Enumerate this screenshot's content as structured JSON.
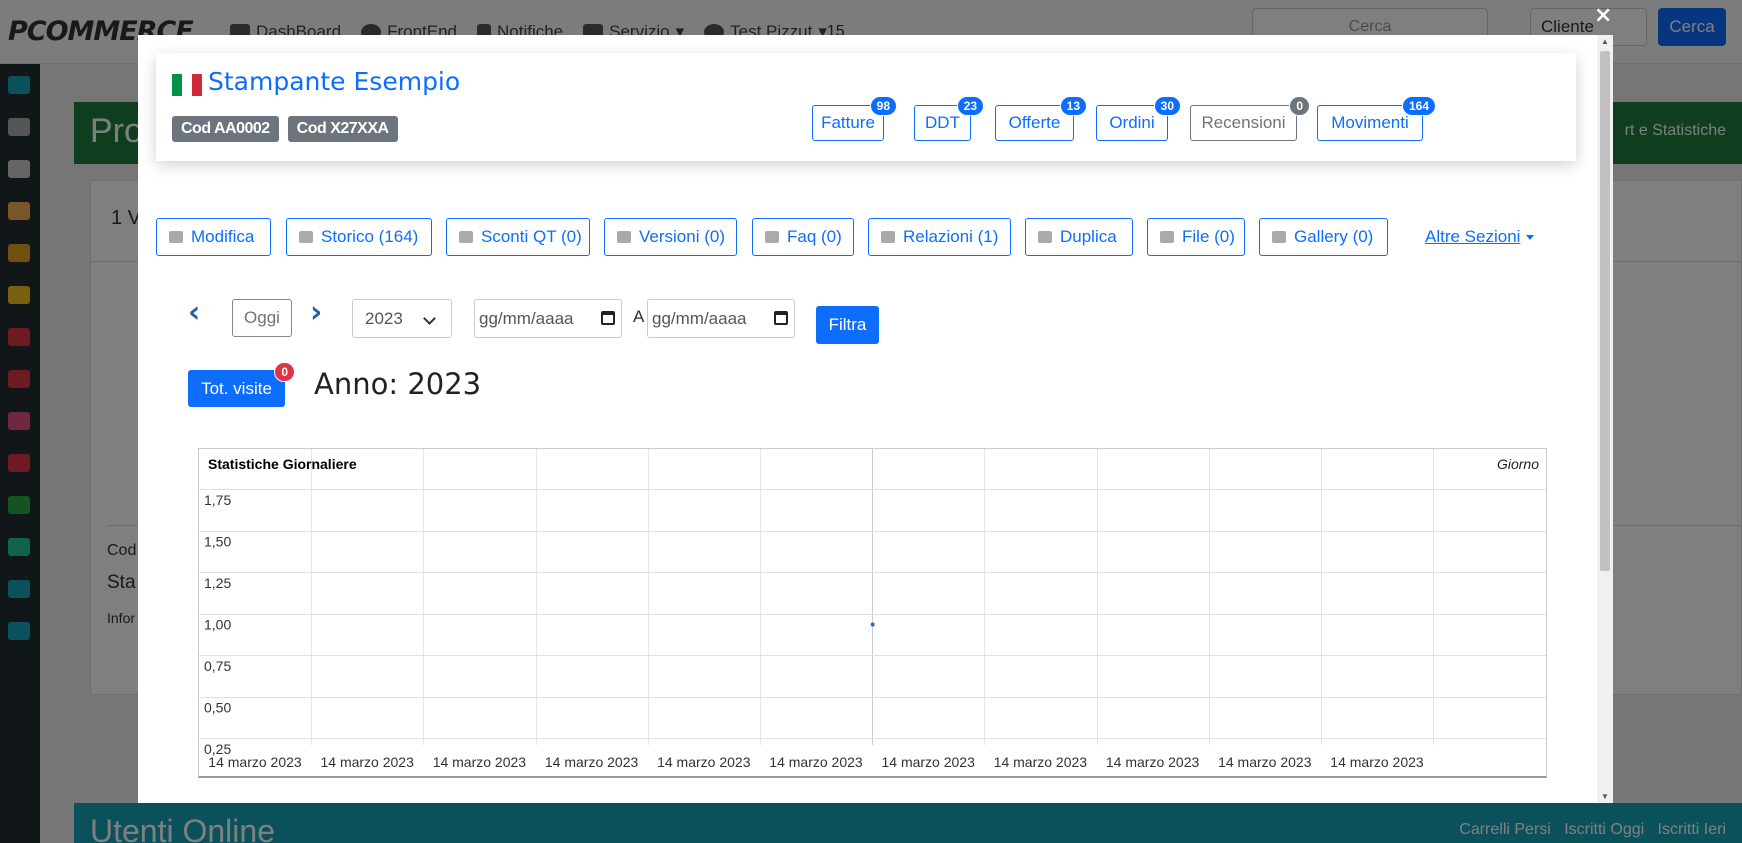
{
  "topbar": {
    "brand": "PCOMMERCE",
    "nav": [
      "DashBoard",
      "FrontEnd",
      "Notifiche",
      "Servizio",
      "Test Pizzut"
    ],
    "notifiche_badge": "15",
    "search_placeholder": "Cerca",
    "select_value": "Cliente",
    "search_button": "Cerca"
  },
  "background": {
    "section_title": "Pro",
    "section_right": "rt e Statistiche",
    "card_text_1": "1 V",
    "card_text_2": "Cod",
    "card_text_3": "Sta",
    "card_text_4": "Infor",
    "online_title": "Utenti Online",
    "online_links": [
      "Carrelli Persi",
      "Iscritti Oggi",
      "Iscritti Ieri"
    ]
  },
  "modal": {
    "close": "×",
    "title": "Stampante Esempio",
    "flag_colors": [
      "#009246",
      "#ffffff",
      "#ce2b37"
    ],
    "codes": [
      "Cod AA0002",
      "Cod X27XXA"
    ],
    "header_buttons": [
      {
        "label": "Fatture",
        "badge": "98"
      },
      {
        "label": "DDT",
        "badge": "23"
      },
      {
        "label": "Offerte",
        "badge": "13"
      },
      {
        "label": "Ordini",
        "badge": "30"
      },
      {
        "label": "Recensioni",
        "badge": "0"
      },
      {
        "label": "Movimenti",
        "badge": "164"
      }
    ],
    "section_buttons": [
      {
        "label": "Modifica",
        "icon": "pencil-icon"
      },
      {
        "label": "Storico (164)",
        "icon": "history-icon"
      },
      {
        "label": "Sconti QT (0)",
        "icon": "percent-icon"
      },
      {
        "label": "Versioni (0)",
        "icon": "tag-icon"
      },
      {
        "label": "Faq (0)",
        "icon": "comment-icon"
      },
      {
        "label": "Relazioni (1)",
        "icon": "retweet-icon"
      },
      {
        "label": "Duplica",
        "icon": "copy-icon"
      },
      {
        "label": "File (0)",
        "icon": "paperclip-icon"
      },
      {
        "label": "Gallery (0)",
        "icon": "camera-icon"
      }
    ],
    "altre_sezioni": "Altre Sezioni",
    "filters": {
      "oggi": "Oggi",
      "year": "2023",
      "date_from_placeholder": "gg/mm/aaaa",
      "date_to_placeholder": "gg/mm/aaaa",
      "a_label": "A",
      "filtra": "Filtra"
    },
    "tot_visite": {
      "label": "Tot. visite",
      "badge": "0"
    },
    "anno_label": "Anno: 2023"
  },
  "chart_data": {
    "type": "line",
    "title": "Statistiche Giornaliere",
    "legend_label": "Giorno",
    "y_ticks": [
      "1,75",
      "1,50",
      "1,25",
      "1,00",
      "0,75",
      "0,50",
      "0,25"
    ],
    "x_ticks": [
      "14 marzo 2023",
      "14 marzo 2023",
      "14 marzo 2023",
      "14 marzo 2023",
      "14 marzo 2023",
      "14 marzo 2023",
      "14 marzo 2023",
      "14 marzo 2023",
      "14 marzo 2023",
      "14 marzo 2023",
      "14 marzo 2023"
    ],
    "ylim": [
      0.25,
      1.75
    ],
    "series": [
      {
        "x": [
          "14 marzo 2023"
        ],
        "values": [
          1.0
        ]
      }
    ],
    "grid": true,
    "point_color": "#3366cc"
  }
}
